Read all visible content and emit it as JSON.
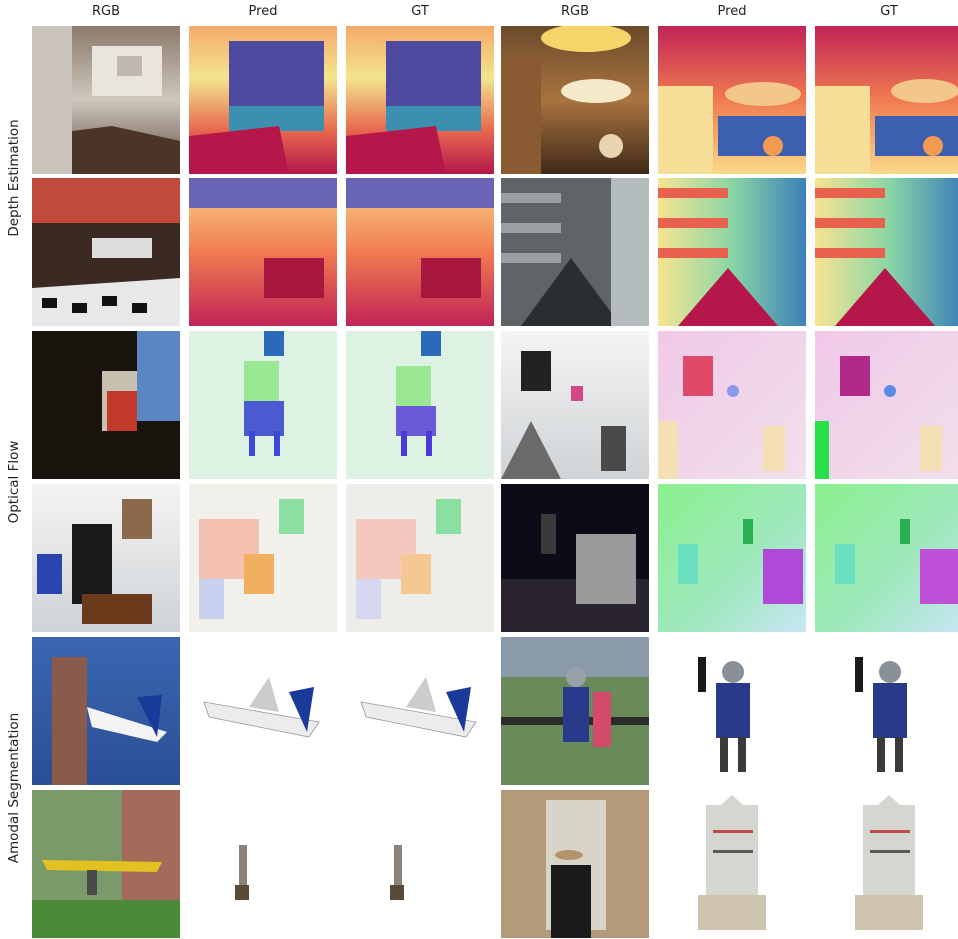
{
  "columns": [
    "RGB",
    "Pred",
    "GT",
    "RGB",
    "Pred",
    "GT"
  ],
  "groups": [
    {
      "label": "Depth Estimation"
    },
    {
      "label": "Optical Flow"
    },
    {
      "label": "Amodal Segmentation"
    }
  ],
  "colors": {
    "depth_far": "#3b3f9e",
    "depth_mid": "#7fd0a6",
    "depth_near": "#b5174a",
    "flow_bg": "#e8f4ea",
    "seg_bg": "#ffffff"
  }
}
